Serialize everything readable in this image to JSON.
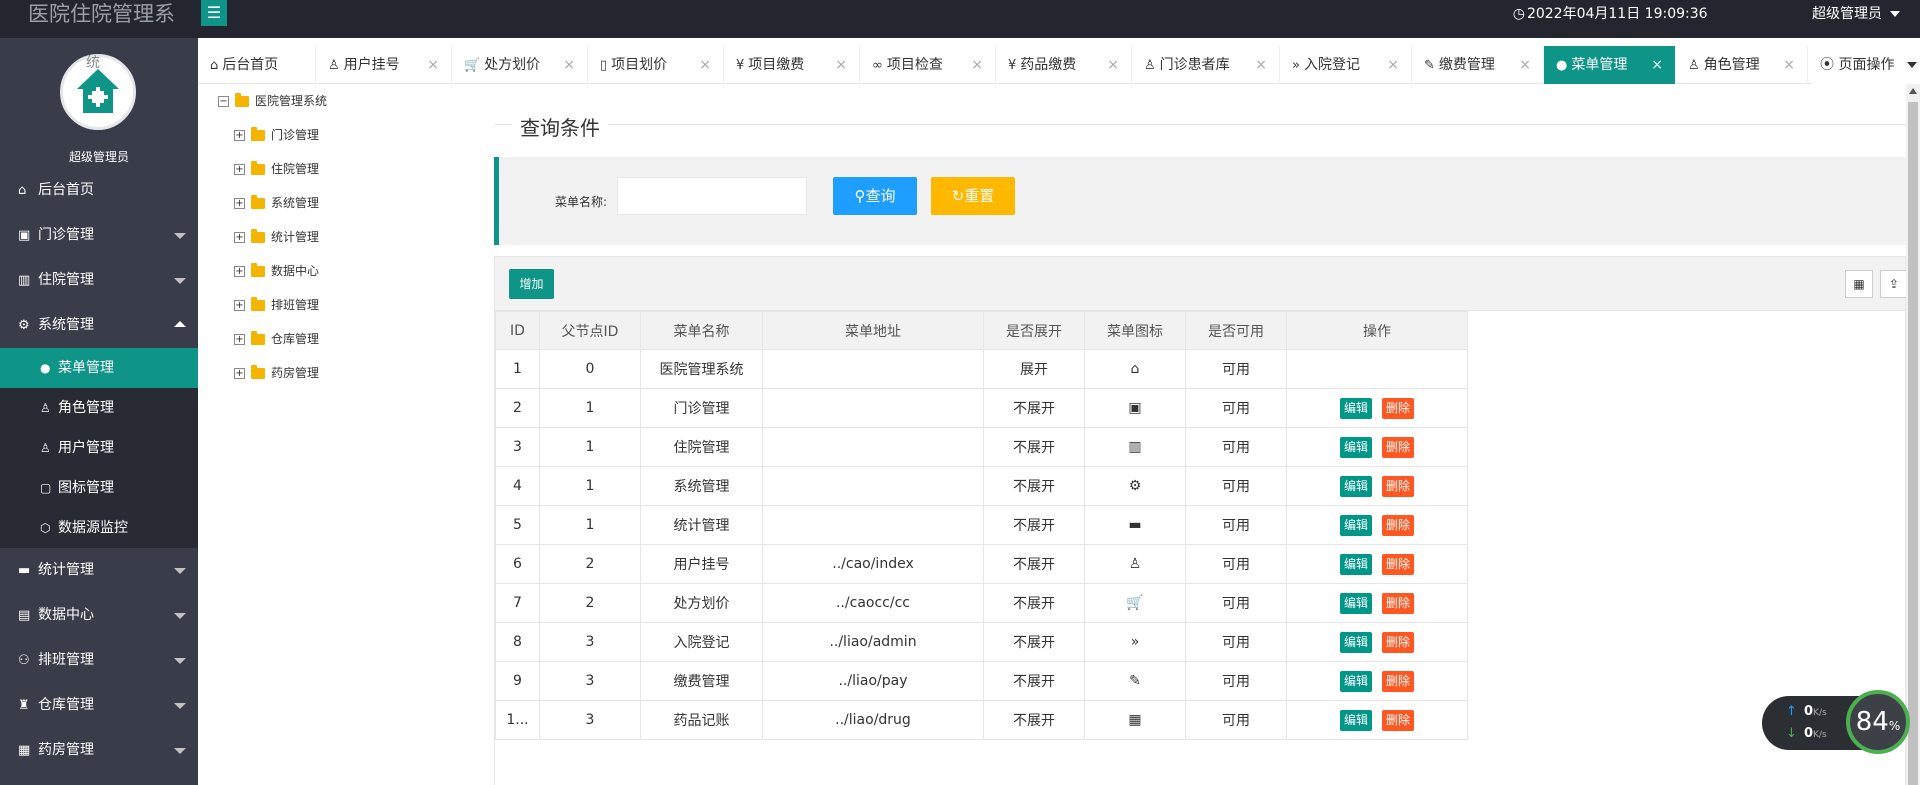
{
  "header": {
    "app_title": "医院住院管理系",
    "menu_toggle": "☰",
    "datetime": "2022年04月11日 19:09:36",
    "user": "超级管理员"
  },
  "sidebar": {
    "avatar_tag": "统",
    "user_name": "超级管理员",
    "items": [
      {
        "label": "后台首页",
        "icon": "home-icon",
        "glyph": "⌂",
        "has_arrow": false
      },
      {
        "label": "门诊管理",
        "icon": "apps-icon",
        "glyph": "▣",
        "has_arrow": true
      },
      {
        "label": "住院管理",
        "icon": "building-icon",
        "glyph": "▥",
        "has_arrow": true
      },
      {
        "label": "系统管理",
        "icon": "gear-icon",
        "glyph": "⚙",
        "has_arrow": true,
        "expanded": true
      },
      {
        "label": "统计管理",
        "icon": "chat-icon",
        "glyph": "▬",
        "has_arrow": true
      },
      {
        "label": "数据中心",
        "icon": "file-icon",
        "glyph": "▤",
        "has_arrow": true
      },
      {
        "label": "排班管理",
        "icon": "user-icon",
        "glyph": "⚇",
        "has_arrow": true
      },
      {
        "label": "仓库管理",
        "icon": "warehouse-icon",
        "glyph": "♜",
        "has_arrow": true
      },
      {
        "label": "药房管理",
        "icon": "book-icon",
        "glyph": "▦",
        "has_arrow": true
      }
    ],
    "sub_items": [
      {
        "label": "菜单管理",
        "icon": "circle-icon",
        "glyph": "●",
        "active": true
      },
      {
        "label": "角色管理",
        "icon": "user-icon",
        "glyph": "♙"
      },
      {
        "label": "用户管理",
        "icon": "user-icon",
        "glyph": "♙"
      },
      {
        "label": "图标管理",
        "icon": "picture-icon",
        "glyph": "▢"
      },
      {
        "label": "数据源监控",
        "icon": "cube-icon",
        "glyph": "⬡"
      }
    ]
  },
  "tabs": [
    {
      "label": "后台首页",
      "glyph": "⌂",
      "closable": false
    },
    {
      "label": "用户挂号",
      "glyph": "♙",
      "closable": true
    },
    {
      "label": "处方划价",
      "glyph": "🛒",
      "closable": true
    },
    {
      "label": "项目划价",
      "glyph": "▯",
      "closable": true
    },
    {
      "label": "项目缴费",
      "glyph": "¥",
      "closable": true
    },
    {
      "label": "项目检查",
      "glyph": "∞",
      "closable": true
    },
    {
      "label": "药品缴费",
      "glyph": "¥",
      "closable": true
    },
    {
      "label": "门诊患者库",
      "glyph": "♙",
      "closable": true
    },
    {
      "label": "入院登记",
      "glyph": "»",
      "closable": true
    },
    {
      "label": "缴费管理",
      "glyph": "✎",
      "closable": true
    },
    {
      "label": "菜单管理",
      "glyph": "●",
      "closable": true,
      "active": true
    },
    {
      "label": "角色管理",
      "glyph": "♙",
      "closable": true
    }
  ],
  "tab_ops": "页面操作",
  "tree": {
    "root": "医院管理系统",
    "nodes": [
      "门诊管理",
      "住院管理",
      "系统管理",
      "统计管理",
      "数据中心",
      "排班管理",
      "仓库管理",
      "药房管理"
    ]
  },
  "query": {
    "legend": "查询条件",
    "label": "菜单名称:",
    "input_value": "",
    "search_btn": "查询",
    "reset_btn": "重置"
  },
  "table": {
    "add_btn": "增加",
    "columns": [
      "ID",
      "父节点ID",
      "菜单名称",
      "菜单地址",
      "是否展开",
      "菜单图标",
      "是否可用",
      "操作"
    ],
    "rows": [
      {
        "id": "1",
        "pid": "0",
        "name": "医院管理系统",
        "url": "",
        "expand": "展开",
        "icon": "⌂",
        "avail": "可用",
        "ops": false
      },
      {
        "id": "2",
        "pid": "1",
        "name": "门诊管理",
        "url": "",
        "expand": "不展开",
        "icon": "▣",
        "avail": "可用",
        "ops": true
      },
      {
        "id": "3",
        "pid": "1",
        "name": "住院管理",
        "url": "",
        "expand": "不展开",
        "icon": "▥",
        "avail": "可用",
        "ops": true
      },
      {
        "id": "4",
        "pid": "1",
        "name": "系统管理",
        "url": "",
        "expand": "不展开",
        "icon": "⚙",
        "avail": "可用",
        "ops": true
      },
      {
        "id": "5",
        "pid": "1",
        "name": "统计管理",
        "url": "",
        "expand": "不展开",
        "icon": "▬",
        "avail": "可用",
        "ops": true
      },
      {
        "id": "6",
        "pid": "2",
        "name": "用户挂号",
        "url": "../cao/index",
        "expand": "不展开",
        "icon": "♙",
        "avail": "可用",
        "ops": true
      },
      {
        "id": "7",
        "pid": "2",
        "name": "处方划价",
        "url": "../caocc/cc",
        "expand": "不展开",
        "icon": "🛒",
        "avail": "可用",
        "ops": true
      },
      {
        "id": "8",
        "pid": "3",
        "name": "入院登记",
        "url": "../liao/admin",
        "expand": "不展开",
        "icon": "»",
        "avail": "可用",
        "ops": true
      },
      {
        "id": "9",
        "pid": "3",
        "name": "缴费管理",
        "url": "../liao/pay",
        "expand": "不展开",
        "icon": "✎",
        "avail": "可用",
        "ops": true
      },
      {
        "id": "1...",
        "pid": "3",
        "name": "药品记账",
        "url": "../liao/drug",
        "expand": "不展开",
        "icon": "▦",
        "avail": "可用",
        "ops": true
      }
    ],
    "edit_label": "编辑",
    "delete_label": "删除"
  },
  "speed": {
    "up": "0",
    "down": "0",
    "unit": "K/s",
    "percent": "84",
    "percent_unit": "%"
  },
  "colors": {
    "brand": "#0f9488",
    "sidebar": "#393d49",
    "search": "#1e9fff",
    "reset": "#ffb800",
    "delete": "#ff5722"
  }
}
